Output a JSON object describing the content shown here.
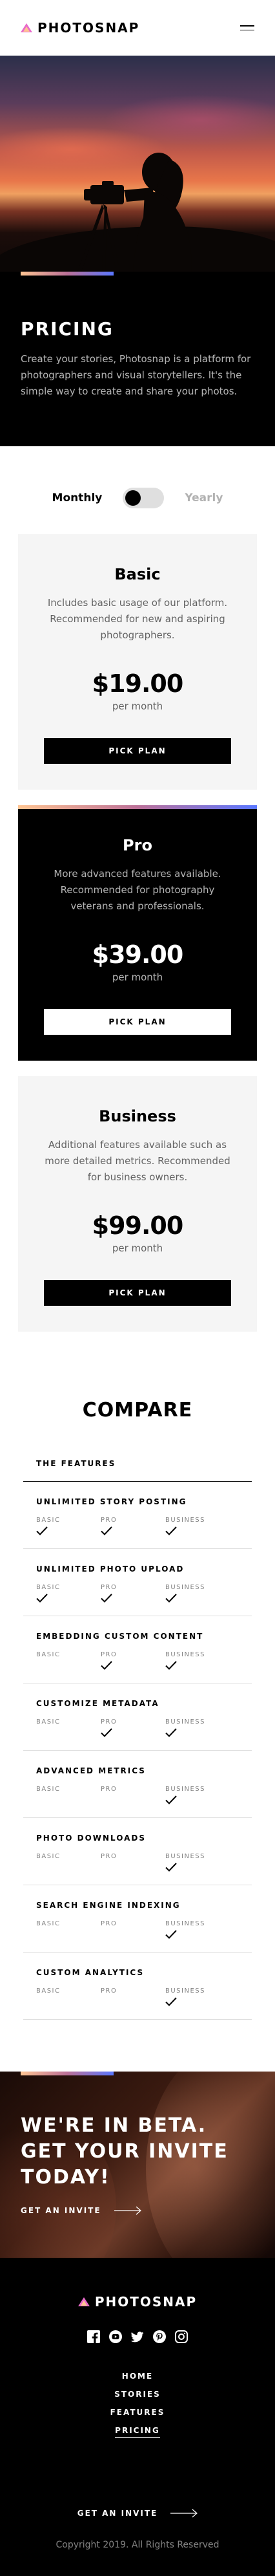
{
  "header": {
    "brand": "PHOTOSNAP",
    "menu_icon": "hamburger-menu-icon"
  },
  "hero": {
    "title": "PRICING",
    "description": "Create your stories, Photosnap is a platform for photographers and visual storytellers. It's the simple way to create and share your photos."
  },
  "billing": {
    "monthly_label": "Monthly",
    "yearly_label": "Yearly",
    "selected": "Monthly"
  },
  "plans": [
    {
      "name": "Basic",
      "description": "Includes basic usage of our platform. Recommended for new and aspiring photographers.",
      "price": "$19.00",
      "period": "per month",
      "cta": "PICK PLAN"
    },
    {
      "name": "Pro",
      "description": "More advanced features available. Recommended for photography veterans and professionals.",
      "price": "$39.00",
      "period": "per month",
      "cta": "PICK PLAN"
    },
    {
      "name": "Business",
      "description": "Additional features available such as more detailed metrics. Recommended for business owners.",
      "price": "$99.00",
      "period": "per month",
      "cta": "PICK PLAN"
    }
  ],
  "compare": {
    "title": "COMPARE",
    "header": "THE FEATURES",
    "tier_labels": [
      "BASIC",
      "PRO",
      "BUSINESS"
    ],
    "features": [
      {
        "name": "UNLIMITED STORY POSTING",
        "basic": true,
        "pro": true,
        "business": true
      },
      {
        "name": "UNLIMITED PHOTO UPLOAD",
        "basic": true,
        "pro": true,
        "business": true
      },
      {
        "name": "EMBEDDING CUSTOM CONTENT",
        "basic": false,
        "pro": true,
        "business": true
      },
      {
        "name": "CUSTOMIZE METADATA",
        "basic": false,
        "pro": true,
        "business": true
      },
      {
        "name": "ADVANCED METRICS",
        "basic": false,
        "pro": false,
        "business": true
      },
      {
        "name": "PHOTO DOWNLOADS",
        "basic": false,
        "pro": false,
        "business": true
      },
      {
        "name": "SEARCH ENGINE INDEXING",
        "basic": false,
        "pro": false,
        "business": true
      },
      {
        "name": "CUSTOM ANALYTICS",
        "basic": false,
        "pro": false,
        "business": true
      }
    ]
  },
  "beta": {
    "title_lines": [
      "WE'RE IN BETA.",
      "GET YOUR INVITE",
      "TODAY!"
    ],
    "cta": "GET AN INVITE"
  },
  "footer": {
    "brand": "PHOTOSNAP",
    "socials": [
      "facebook-icon",
      "youtube-icon",
      "twitter-icon",
      "pinterest-icon",
      "instagram-icon"
    ],
    "nav": [
      {
        "label": "HOME",
        "active": false
      },
      {
        "label": "STORIES",
        "active": false
      },
      {
        "label": "FEATURES",
        "active": false
      },
      {
        "label": "PRICING",
        "active": true
      }
    ],
    "cta": "GET AN INVITE",
    "copyright": "Copyright 2019. All Rights Reserved"
  },
  "colors": {
    "accent_start": "#ffc593",
    "accent_mid": "#bc7198",
    "accent_end": "#5a77ff",
    "card_light": "#f5f5f5",
    "dark": "#000000"
  }
}
